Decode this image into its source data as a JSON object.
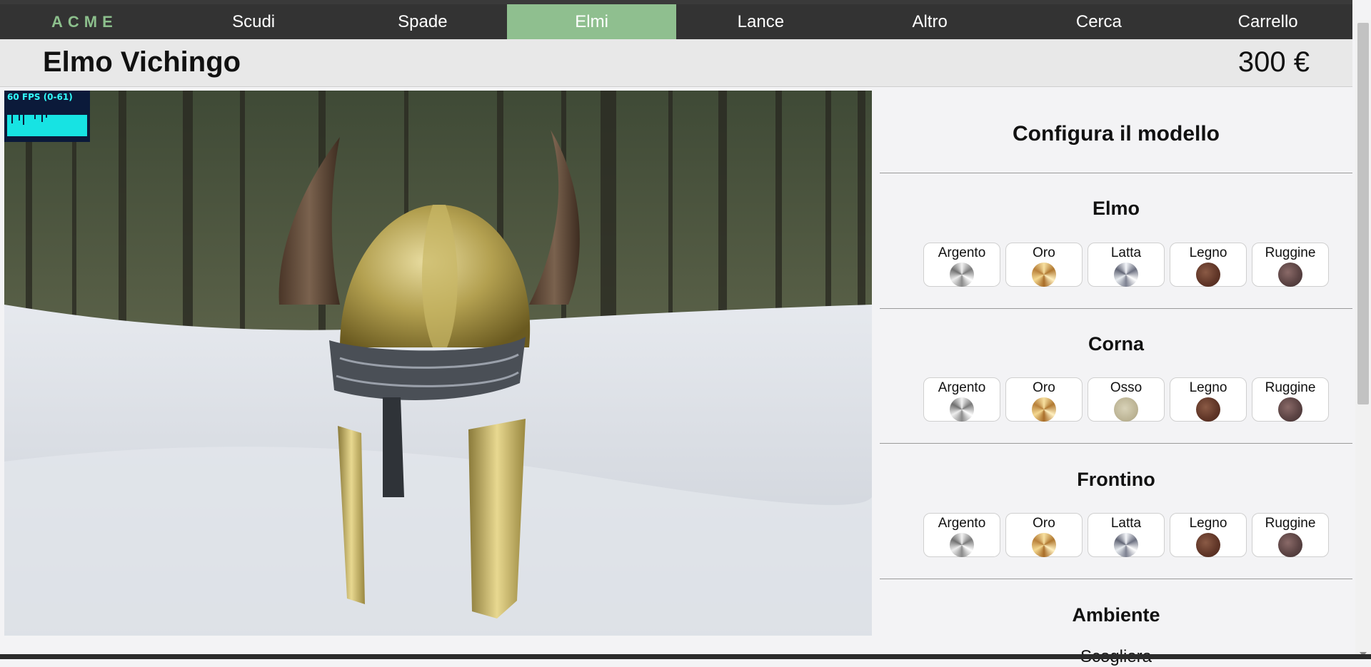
{
  "nav": {
    "brand": "ACME",
    "items": [
      "Scudi",
      "Spade",
      "Elmi",
      "Lance",
      "Altro",
      "Cerca",
      "Carrello"
    ],
    "active": "Elmi"
  },
  "product": {
    "title": "Elmo Vichingo",
    "price": "300 €"
  },
  "viewer": {
    "fps_label": "60 FPS (0-61)"
  },
  "config": {
    "title": "Configura il modello",
    "sections": [
      {
        "title": "Elmo",
        "options": [
          {
            "label": "Argento",
            "swatch": "argento"
          },
          {
            "label": "Oro",
            "swatch": "oro"
          },
          {
            "label": "Latta",
            "swatch": "latta"
          },
          {
            "label": "Legno",
            "swatch": "legno"
          },
          {
            "label": "Ruggine",
            "swatch": "ruggine"
          }
        ]
      },
      {
        "title": "Corna",
        "options": [
          {
            "label": "Argento",
            "swatch": "argento"
          },
          {
            "label": "Oro",
            "swatch": "oro"
          },
          {
            "label": "Osso",
            "swatch": "osso"
          },
          {
            "label": "Legno",
            "swatch": "legno"
          },
          {
            "label": "Ruggine",
            "swatch": "ruggine"
          }
        ]
      },
      {
        "title": "Frontino",
        "options": [
          {
            "label": "Argento",
            "swatch": "argento"
          },
          {
            "label": "Oro",
            "swatch": "oro"
          },
          {
            "label": "Latta",
            "swatch": "latta"
          },
          {
            "label": "Legno",
            "swatch": "legno"
          },
          {
            "label": "Ruggine",
            "swatch": "ruggine"
          }
        ]
      }
    ],
    "ambiente": {
      "title": "Ambiente",
      "value": "Scogliera"
    }
  },
  "colors": {
    "navbar": "#333333",
    "brand": "#8cbf8c",
    "active_tab": "#8fbf8f",
    "fps_text": "#33ffff",
    "fps_graph": "#17e3e3"
  }
}
